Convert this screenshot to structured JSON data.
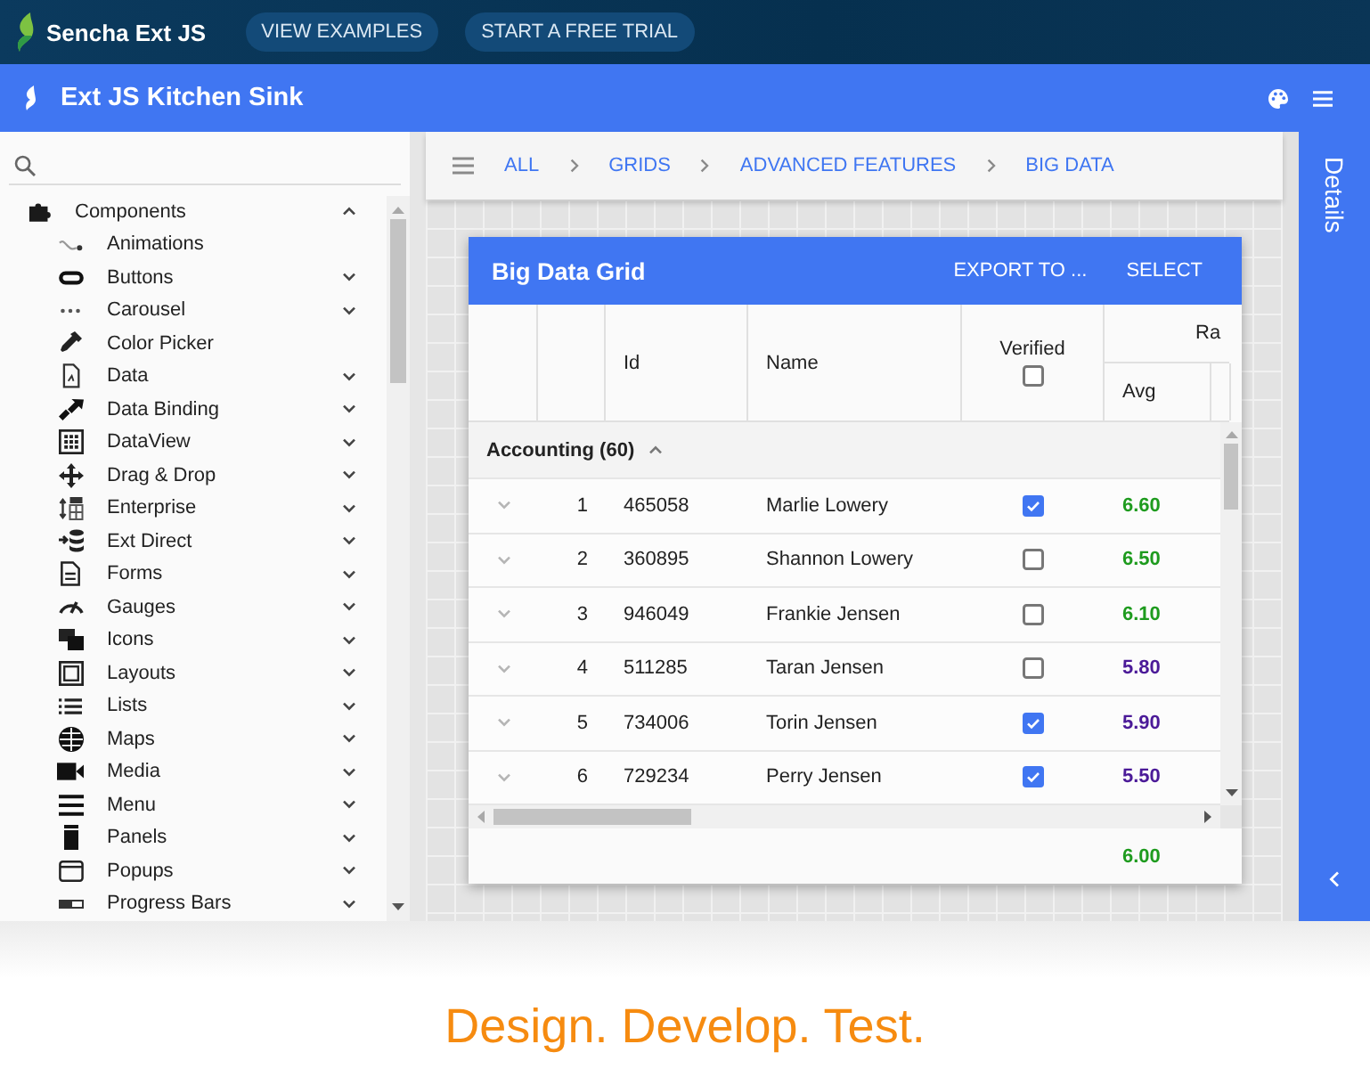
{
  "top_bar": {
    "brand": "Sencha Ext JS",
    "buttons": [
      "VIEW EXAMPLES",
      "START A FREE TRIAL"
    ]
  },
  "app_header": {
    "title": "Ext JS Kitchen Sink"
  },
  "sidebar": {
    "items": [
      {
        "label": "Components",
        "kind": "folder",
        "expanded": true,
        "children": [
          {
            "label": "Animations",
            "kind": "leaf"
          },
          {
            "label": "Buttons",
            "kind": "folder",
            "expanded": false
          },
          {
            "label": "Carousel",
            "kind": "folder",
            "expanded": false
          },
          {
            "label": "Color Picker",
            "kind": "leaf"
          },
          {
            "label": "Data",
            "kind": "folder",
            "expanded": false
          },
          {
            "label": "Data Binding",
            "kind": "folder",
            "expanded": false
          },
          {
            "label": "DataView",
            "kind": "folder",
            "expanded": false
          },
          {
            "label": "Drag & Drop",
            "kind": "folder",
            "expanded": false
          },
          {
            "label": "Enterprise",
            "kind": "folder",
            "expanded": false
          },
          {
            "label": "Ext Direct",
            "kind": "folder",
            "expanded": false
          },
          {
            "label": "Forms",
            "kind": "folder",
            "expanded": false
          },
          {
            "label": "Gauges",
            "kind": "folder",
            "expanded": false
          },
          {
            "label": "Icons",
            "kind": "folder",
            "expanded": false
          },
          {
            "label": "Layouts",
            "kind": "folder",
            "expanded": false
          },
          {
            "label": "Lists",
            "kind": "folder",
            "expanded": false
          },
          {
            "label": "Maps",
            "kind": "folder",
            "expanded": false
          },
          {
            "label": "Media",
            "kind": "folder",
            "expanded": false
          },
          {
            "label": "Menu",
            "kind": "folder",
            "expanded": false
          },
          {
            "label": "Panels",
            "kind": "folder",
            "expanded": false
          },
          {
            "label": "Popups",
            "kind": "folder",
            "expanded": false
          },
          {
            "label": "Progress Bars",
            "kind": "folder",
            "expanded": false
          }
        ]
      }
    ]
  },
  "breadcrumb": [
    "ALL",
    "GRIDS",
    "ADVANCED FEATURES",
    "BIG DATA"
  ],
  "grid": {
    "title": "Big Data Grid",
    "tools": [
      "EXPORT TO ...",
      "SELECT"
    ],
    "columns": [
      {
        "label": "Id",
        "kind": "text"
      },
      {
        "label": "Name",
        "kind": "text"
      },
      {
        "label": "Verified",
        "kind": "check",
        "checked": false
      }
    ],
    "column_group": {
      "label": "Ra",
      "columns": [
        "Avg"
      ]
    },
    "group": {
      "label": "Accounting (60)",
      "expanded": true
    },
    "rows": [
      {
        "number": "1",
        "id": "465058",
        "name": "Marlie Lowery",
        "verified": true,
        "avg": "6.60",
        "color": "#1e9b1e",
        "expanded": false
      },
      {
        "number": "2",
        "id": "360895",
        "name": "Shannon Lowery",
        "verified": false,
        "avg": "6.50",
        "color": "#1e9b1e",
        "expanded": false
      },
      {
        "number": "3",
        "id": "946049",
        "name": "Frankie Jensen",
        "verified": false,
        "avg": "6.10",
        "color": "#1e9b1e",
        "expanded": false
      },
      {
        "number": "4",
        "id": "511285",
        "name": "Taran Jensen",
        "verified": false,
        "avg": "5.80",
        "color": "#4b1a98",
        "expanded": false
      },
      {
        "number": "5",
        "id": "734006",
        "name": "Torin Jensen",
        "verified": true,
        "avg": "5.90",
        "color": "#4b1a98",
        "expanded": false
      },
      {
        "number": "6",
        "id": "729234",
        "name": "Perry Jensen",
        "verified": true,
        "avg": "5.50",
        "color": "#4b1a98",
        "expanded": false
      }
    ],
    "summary": {
      "avg": "6.00"
    }
  },
  "details": {
    "title": "Details"
  },
  "footer": {
    "tagline": "Design. Develop. Test."
  }
}
